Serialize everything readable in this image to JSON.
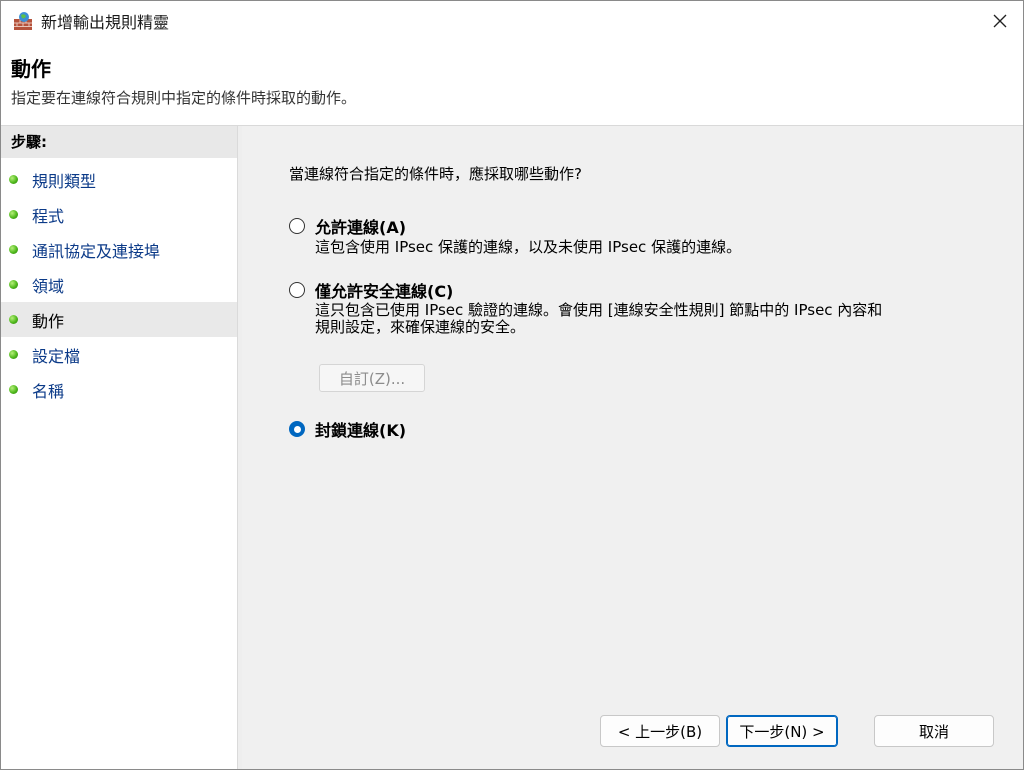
{
  "window": {
    "title": "新增輸出規則精靈"
  },
  "header": {
    "title": "動作",
    "description": "指定要在連線符合規則中指定的條件時採取的動作。"
  },
  "sidebar": {
    "heading": "步驟:",
    "items": [
      {
        "label": "規則類型"
      },
      {
        "label": "程式"
      },
      {
        "label": "通訊協定及連接埠"
      },
      {
        "label": "領域"
      },
      {
        "label": "動作"
      },
      {
        "label": "設定檔"
      },
      {
        "label": "名稱"
      }
    ],
    "active_index": 4
  },
  "main": {
    "question": "當連線符合指定的條件時，應採取哪些動作?",
    "options": [
      {
        "label": "允許連線(A)",
        "description": "這包含使用 IPsec 保護的連線，以及未使用 IPsec 保護的連線。",
        "checked": false
      },
      {
        "label": "僅允許安全連線(C)",
        "description_line1": "這只包含已使用 IPsec 驗證的連線。會使用 [連線安全性規則] 節點中的 IPsec 內容和",
        "description_line2": "規則設定，來確保連線的安全。",
        "checked": false
      },
      {
        "label": "封鎖連線(K)",
        "checked": true
      }
    ],
    "custom_button": "自訂(Z)..."
  },
  "footer": {
    "back": "< 上一步(B)",
    "next": "下一步(N) >",
    "cancel": "取消"
  },
  "colors": {
    "accent": "#0067c0",
    "link": "#0b3a88",
    "step_dot": "#4fb81c"
  }
}
